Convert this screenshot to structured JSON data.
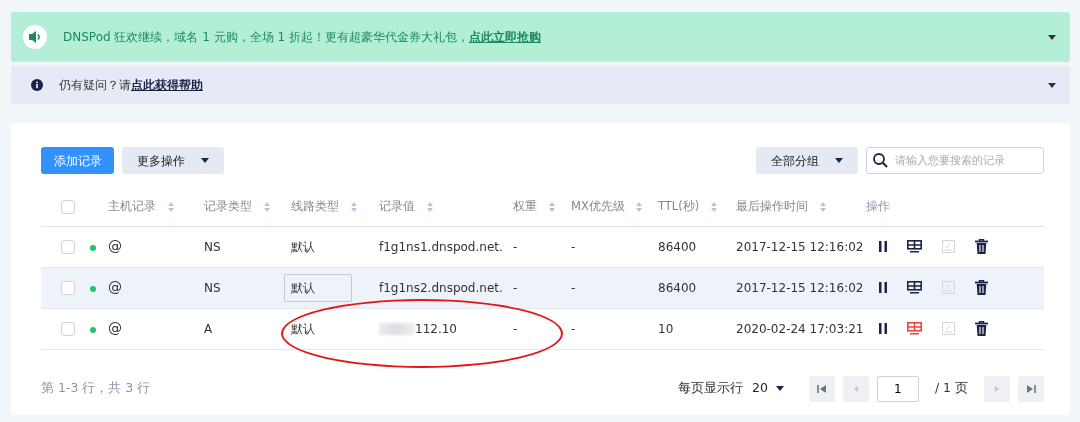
{
  "promo_banner": {
    "text": "DNSPod 狂欢继续，域名 1 元购，全场 1 折起！更有超豪华代金券大礼包，",
    "link": "点此立即抢购",
    "expanded": false
  },
  "help_banner": {
    "text": "仍有疑问？请",
    "link": "点此获得帮助",
    "expanded": false
  },
  "toolbar": {
    "add_button": "添加记录",
    "more_button": "更多操作",
    "group_button": "全部分组",
    "search": {
      "placeholder": "请输入您要搜索的记录"
    }
  },
  "table": {
    "select_all": false,
    "columns": [
      {
        "label": "主机记录",
        "sortable": true
      },
      {
        "label": "记录类型",
        "sortable": true
      },
      {
        "label": "线路类型",
        "sortable": true
      },
      {
        "label": "记录值",
        "sortable": true
      },
      {
        "label": "权重",
        "sortable": true
      },
      {
        "label": "MX优先级",
        "sortable": true
      },
      {
        "label": "TTL(秒)",
        "sortable": true
      },
      {
        "label": "最后操作时间",
        "sortable": true
      },
      {
        "label": "操作",
        "sortable": false
      }
    ],
    "rows": [
      {
        "checked": false,
        "enabled": true,
        "host": "@",
        "type": "NS",
        "line": "默认",
        "line_editing": false,
        "value": "f1g1ns1.dnspod.net.",
        "value_redacted": false,
        "weight": "-",
        "mx": "-",
        "ttl": "86400",
        "time": "2017-12-15 12:16:02",
        "hovered": false,
        "monitor_alert": false
      },
      {
        "checked": false,
        "enabled": true,
        "host": "@",
        "type": "NS",
        "line": "默认",
        "line_editing": true,
        "value": "f1g1ns2.dnspod.net.",
        "value_redacted": false,
        "weight": "-",
        "mx": "-",
        "ttl": "86400",
        "time": "2017-12-15 12:16:02",
        "hovered": true,
        "monitor_alert": false
      },
      {
        "checked": false,
        "enabled": true,
        "host": "@",
        "type": "A",
        "line": "默认",
        "line_editing": false,
        "value": "112.10",
        "value_redacted": true,
        "weight": "-",
        "mx": "-",
        "ttl": "10",
        "time": "2020-02-24 17:03:21",
        "hovered": false,
        "monitor_alert": true
      }
    ]
  },
  "annotation": {
    "kind": "ellipse"
  },
  "footer": {
    "summary": "第 1-3 行，共 3 行",
    "per_page_label": "每页显示行",
    "per_page": "20",
    "page": "1",
    "page_total": "/ 1 页"
  }
}
